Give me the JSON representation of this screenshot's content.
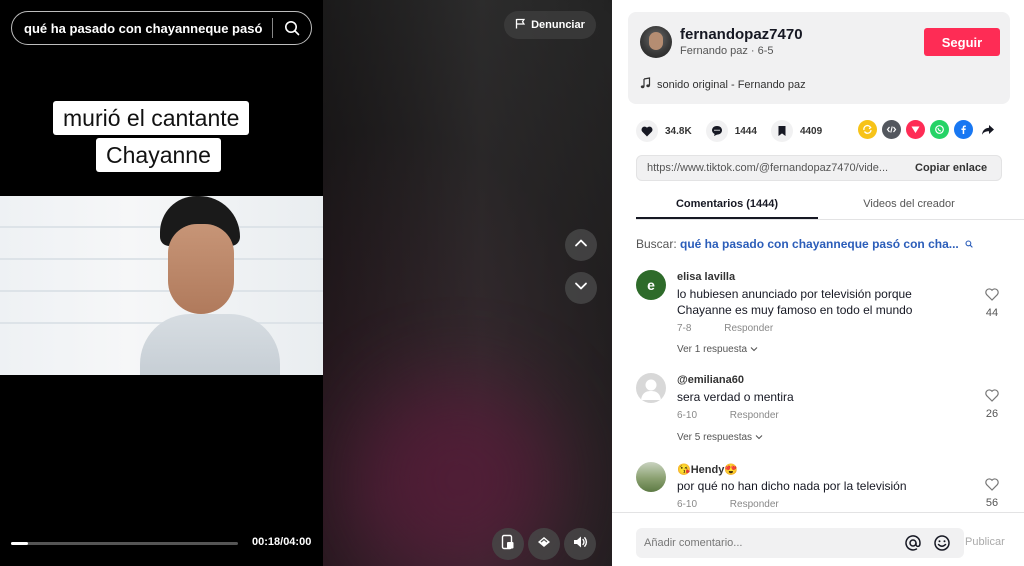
{
  "player": {
    "search_query": "qué ha pasado con chayanneque pasó c...",
    "caption_line1": "murió el cantante",
    "caption_line2": "Chayanne",
    "time": "00:18/04:00",
    "progress": 0.075,
    "report_label": "Denunciar"
  },
  "author": {
    "username": "fernandopaz7470",
    "meta": "Fernando paz · 6-5",
    "follow_label": "Seguir",
    "sound": "sonido original - Fernando paz"
  },
  "stats": {
    "likes": "34.8K",
    "comments": "1444",
    "saves": "4409"
  },
  "share_icons": [
    "repost-icon",
    "embed-icon",
    "send-icon",
    "whatsapp-icon",
    "facebook-icon",
    "share-arrow-icon"
  ],
  "link": {
    "url": "https://www.tiktok.com/@fernandopaz7470/vide...",
    "copy_label": "Copiar enlace"
  },
  "tabs": [
    {
      "label": "Comentarios (1444)",
      "active": true
    },
    {
      "label": "Videos del creador",
      "active": false
    }
  ],
  "search_hint": {
    "prefix": "Buscar: ",
    "query": "qué ha pasado con chayanneque pasó con cha..."
  },
  "comments": [
    {
      "initial": "e",
      "avatar_color": "#2e6b2a",
      "name": "elisa lavilla",
      "text": "lo hubiesen anunciado por televisión porque Chayanne es muy famoso en todo el mundo",
      "date": "7-8",
      "reply_label": "Responder",
      "likes": "44",
      "more": "Ver 1 respuesta"
    },
    {
      "initial": "",
      "avatar_color": "#d8d8d8",
      "name": "@emiliana60",
      "text": "sera verdad o mentira",
      "date": "6-10",
      "reply_label": "Responder",
      "likes": "26",
      "more": "Ver 5 respuestas"
    },
    {
      "initial": "",
      "avatar_color": "#6b8a5a",
      "name": "😘Hendy😍",
      "text": "por qué no han dicho nada por la televisión",
      "date": "6-10",
      "reply_label": "Responder",
      "likes": "56",
      "more": ""
    }
  ],
  "composer": {
    "placeholder": "Añadir comentario...",
    "post_label": "Publicar"
  },
  "colors": {
    "accent": "#fe2c55",
    "link_blue": "#2b5db9"
  }
}
